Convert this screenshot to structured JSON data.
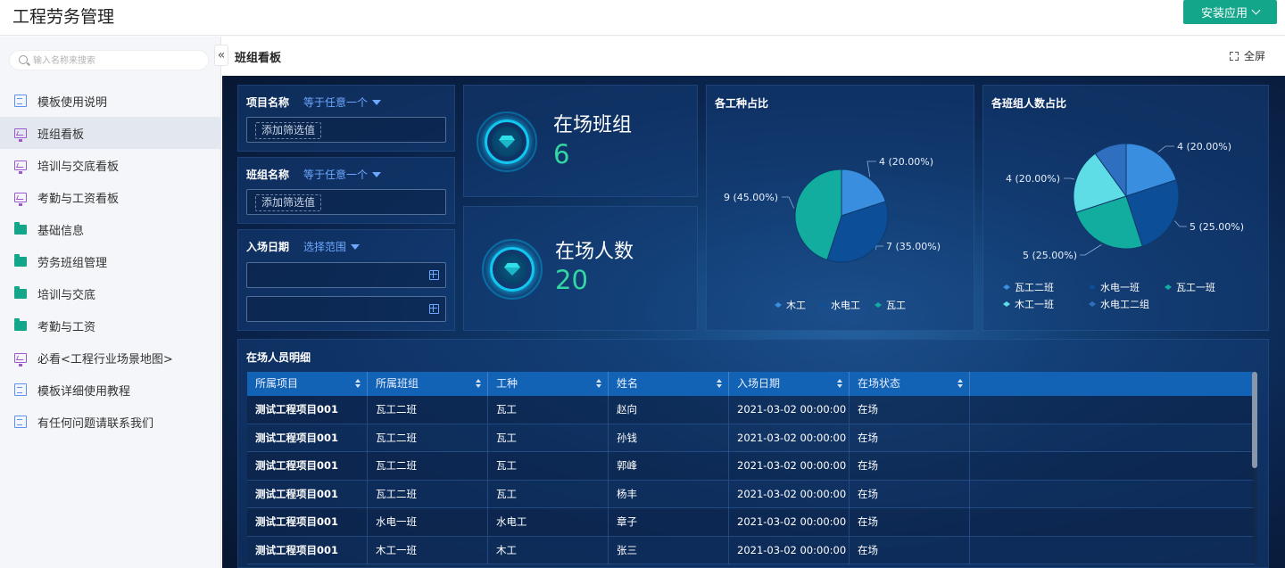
{
  "app": {
    "title": "工程劳务管理",
    "install_button": "安装应用"
  },
  "sidebar": {
    "search_placeholder": "输入名称来搜索",
    "collapse_glyph": "«",
    "items": [
      {
        "label": "模板使用说明",
        "icon": "doc",
        "active": false
      },
      {
        "label": "班组看板",
        "icon": "board",
        "active": true
      },
      {
        "label": "培训与交底看板",
        "icon": "board",
        "active": false
      },
      {
        "label": "考勤与工资看板",
        "icon": "board",
        "active": false
      },
      {
        "label": "基础信息",
        "icon": "folder",
        "active": false
      },
      {
        "label": "劳务班组管理",
        "icon": "folder",
        "active": false
      },
      {
        "label": "培训与交底",
        "icon": "folder",
        "active": false
      },
      {
        "label": "考勤与工资",
        "icon": "folder",
        "active": false
      },
      {
        "label": "必看<工程行业场景地图>",
        "icon": "board",
        "active": false
      },
      {
        "label": "模板详细使用教程",
        "icon": "doc",
        "active": false
      },
      {
        "label": "有任何问题请联系我们",
        "icon": "doc",
        "active": false
      }
    ]
  },
  "page": {
    "title": "班组看板",
    "fullscreen": "全屏"
  },
  "filters": {
    "project": {
      "label": "项目名称",
      "op": "等于任意一个",
      "add": "添加筛选值"
    },
    "team": {
      "label": "班组名称",
      "op": "等于任意一个",
      "add": "添加筛选值"
    },
    "date": {
      "label": "入场日期",
      "op": "选择范围"
    }
  },
  "kpis": {
    "teams": {
      "label": "在场班组",
      "value": "6"
    },
    "people": {
      "label": "在场人数",
      "value": "20"
    }
  },
  "colors": {
    "accent": "#14a68a",
    "kpi_value": "#34d6a3",
    "header_blue": "#1262b5"
  },
  "chart_data": [
    {
      "type": "pie",
      "title": "各工种占比",
      "legend_position": "bottom",
      "series": [
        {
          "name": "木工",
          "value": 4,
          "label": "4 (20.00%)",
          "color": "#3a8ee0"
        },
        {
          "name": "水电工",
          "value": 7,
          "label": "7 (35.00%)",
          "color": "#0c4e98"
        },
        {
          "name": "瓦工",
          "value": 9,
          "label": "9 (45.00%)",
          "color": "#13ada0"
        }
      ]
    },
    {
      "type": "pie",
      "title": "各班组人数占比",
      "legend_position": "bottom",
      "series": [
        {
          "name": "瓦工二班",
          "value": 4,
          "label": "4 (20.00%)",
          "color": "#3a8ee0"
        },
        {
          "name": "水电一班",
          "value": 5,
          "label": "5 (25.00%)",
          "color": "#0c4e98"
        },
        {
          "name": "瓦工一班",
          "value": 5,
          "label": "5 (25.00%)",
          "color": "#13ada0"
        },
        {
          "name": "木工一班",
          "value": 4,
          "label": "4 (20.00%)",
          "color": "#5fdde6"
        },
        {
          "name": "水电工二组",
          "value": 2,
          "label": "",
          "color": "#2f6fbf"
        }
      ]
    }
  ],
  "table": {
    "title": "在场人员明细",
    "columns": [
      "所属项目",
      "所属班组",
      "工种",
      "姓名",
      "入场日期",
      "在场状态"
    ],
    "rows": [
      [
        "测试工程项目001",
        "瓦工二班",
        "瓦工",
        "赵向",
        "2021-03-02 00:00:00",
        "在场"
      ],
      [
        "测试工程项目001",
        "瓦工二班",
        "瓦工",
        "孙钱",
        "2021-03-02 00:00:00",
        "在场"
      ],
      [
        "测试工程项目001",
        "瓦工二班",
        "瓦工",
        "郭峰",
        "2021-03-02 00:00:00",
        "在场"
      ],
      [
        "测试工程项目001",
        "瓦工二班",
        "瓦工",
        "杨丰",
        "2021-03-02 00:00:00",
        "在场"
      ],
      [
        "测试工程项目001",
        "水电一班",
        "水电工",
        "章子",
        "2021-03-02 00:00:00",
        "在场"
      ],
      [
        "测试工程项目001",
        "木工一班",
        "木工",
        "张三",
        "2021-03-02 00:00:00",
        "在场"
      ]
    ]
  }
}
